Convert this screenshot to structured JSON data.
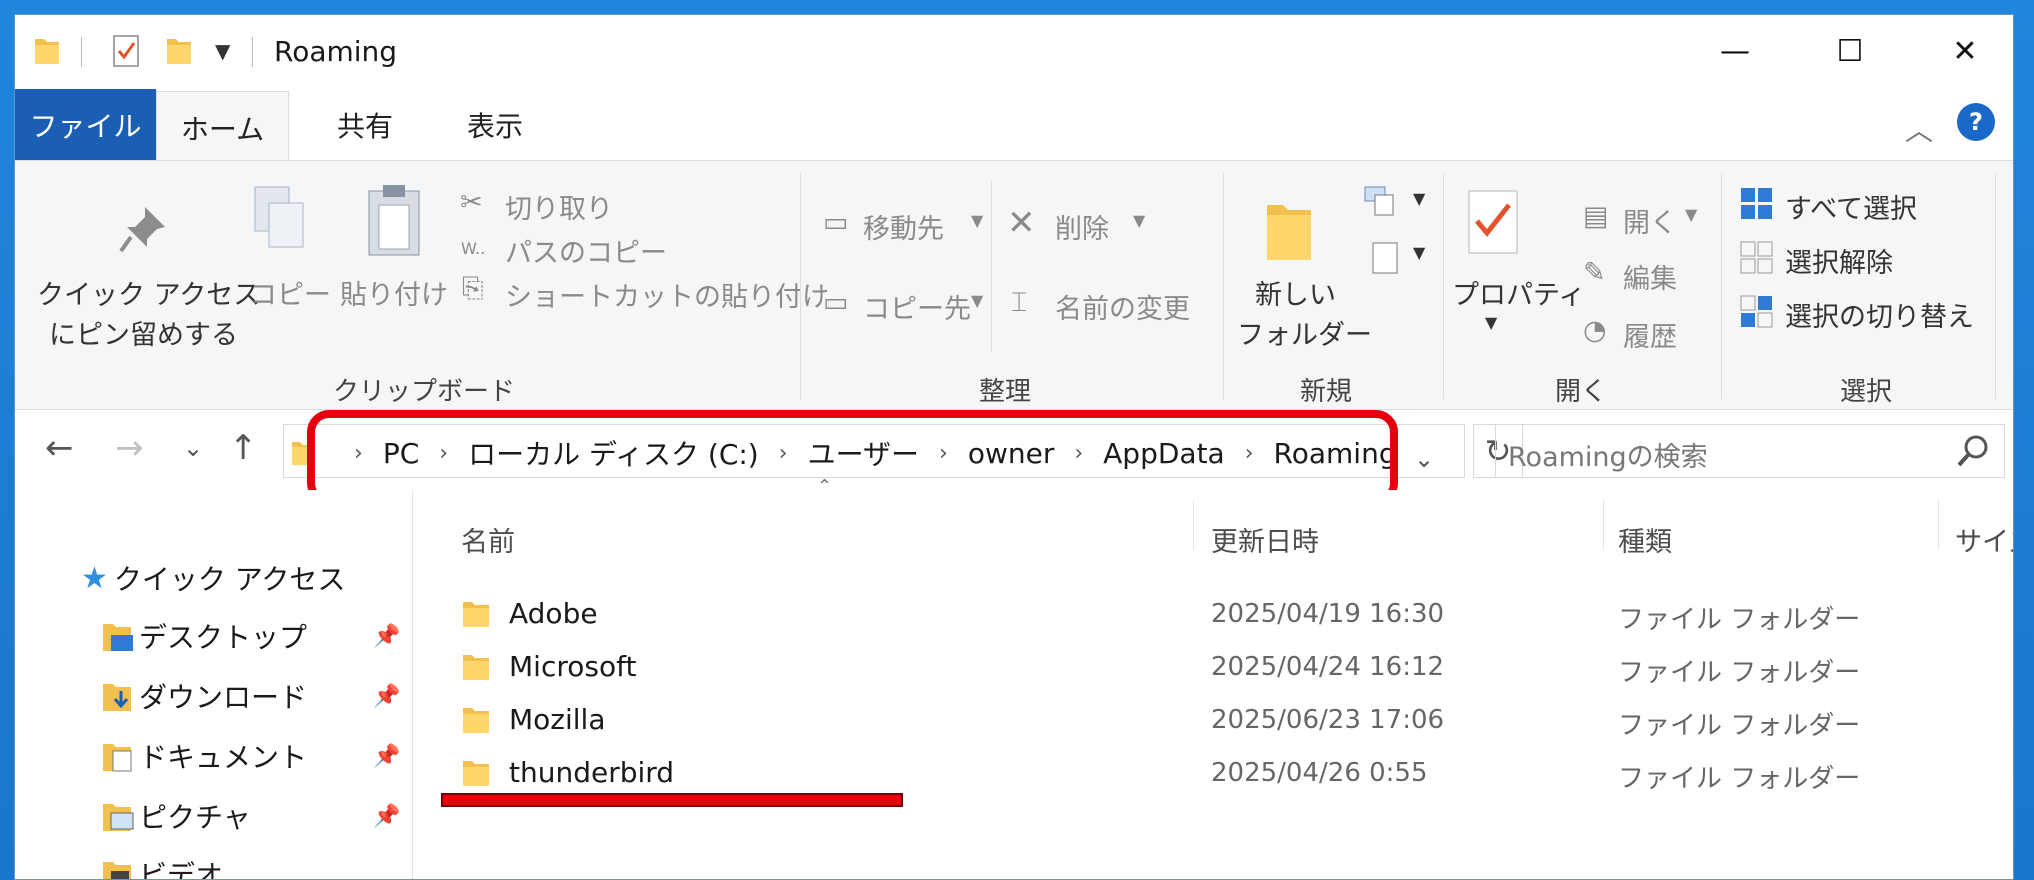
{
  "window": {
    "title": "Roaming",
    "controls": {
      "minimize": "—",
      "maximize": "☐",
      "close": "✕"
    }
  },
  "tabs": [
    {
      "label": "ファイル"
    },
    {
      "label": "ホーム"
    },
    {
      "label": "共有"
    },
    {
      "label": "表示"
    }
  ],
  "ribbon": {
    "clipboard": {
      "group_label": "クリップボード",
      "pin_line1": "クイック アクセス",
      "pin_line2": "にピン留めする",
      "copy": "コピー",
      "paste": "貼り付け",
      "cut": "切り取り",
      "copy_path": "パスのコピー",
      "paste_shortcut": "ショートカットの貼り付け"
    },
    "organize": {
      "group_label": "整理",
      "move_to": "移動先",
      "copy_to": "コピー先",
      "delete": "削除",
      "rename": "名前の変更"
    },
    "new": {
      "group_label": "新規",
      "new_folder_line1": "新しい",
      "new_folder_line2": "フォルダー"
    },
    "open": {
      "group_label": "開く",
      "properties": "プロパティ",
      "open": "開く",
      "edit": "編集",
      "history": "履歴"
    },
    "select": {
      "group_label": "選択",
      "select_all": "すべて選択",
      "select_none": "選択解除",
      "invert": "選択の切り替え"
    }
  },
  "address": {
    "crumbs": [
      "PC",
      "ローカル ディスク (C:)",
      "ユーザー",
      "owner",
      "AppData",
      "Roaming"
    ],
    "search_placeholder": "Roamingの検索"
  },
  "navpane": {
    "items": [
      {
        "label": "クイック アクセス",
        "icon": "star-icon"
      },
      {
        "label": "デスクトップ",
        "icon": "desktop-folder-icon",
        "pinned": true
      },
      {
        "label": "ダウンロード",
        "icon": "download-folder-icon",
        "pinned": true
      },
      {
        "label": "ドキュメント",
        "icon": "documents-folder-icon",
        "pinned": true
      },
      {
        "label": "ピクチャ",
        "icon": "pictures-folder-icon",
        "pinned": true
      },
      {
        "label": "ビデオ",
        "icon": "videos-folder-icon"
      }
    ]
  },
  "filelist": {
    "columns": {
      "name": "名前",
      "modified": "更新日時",
      "type": "種類",
      "size": "サイズ"
    },
    "rows": [
      {
        "name": "Adobe",
        "modified": "2025/04/19 16:30",
        "type": "ファイル フォルダー"
      },
      {
        "name": "Microsoft",
        "modified": "2025/04/24 16:12",
        "type": "ファイル フォルダー"
      },
      {
        "name": "Mozilla",
        "modified": "2025/06/23 17:06",
        "type": "ファイル フォルダー"
      },
      {
        "name": "thunderbird",
        "modified": "2025/04/26 0:55",
        "type": "ファイル フォルダー"
      }
    ]
  },
  "colors": {
    "accent": "#1a5fb4",
    "annotation_red": "#e4000f",
    "folder_yellow": "#f5c542"
  }
}
